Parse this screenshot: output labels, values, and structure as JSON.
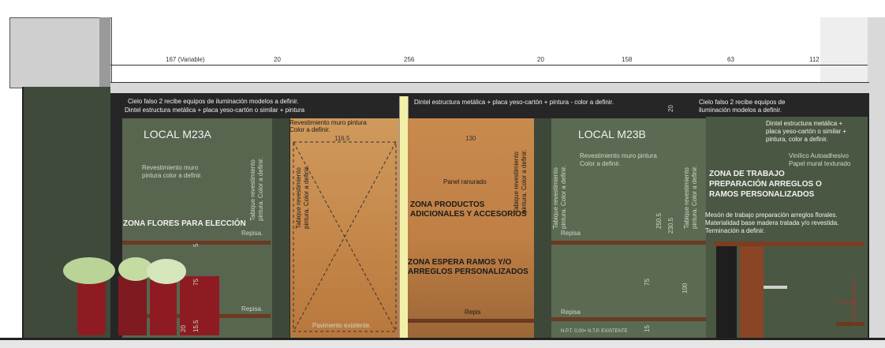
{
  "dimensions_top": [
    "167 (Variable)",
    "20",
    "256",
    "20",
    "158",
    "63",
    "112"
  ],
  "labels": {
    "ceiling_a": "Cielo falso 2 recibe equipos de iluminación modelos a definir.",
    "lintel_a": "Dintel estructura metálica + placa yeso-cartón o similar + pintura",
    "lintel_center": "Dintel estructura metálica + placa yeso-cartón + pintura - color a definir.",
    "ceiling_b_1": "Cielo falso 2 recibe equipos de",
    "ceiling_b_2": "iluminación modelos a definir.",
    "local_a": "LOCAL M23A",
    "local_b": "LOCAL M23B",
    "wall_a_1": "Revestimiento muro",
    "wall_a_2": "pintura color a definir.",
    "wall_b_1": "Revestimiento muro pintura",
    "wall_b_2": "Color a definir.",
    "wall_mid_1": "Revestimiento muro pintura",
    "wall_mid_2": "Color a definir.",
    "partition_1": "Tabique revestimiento",
    "partition_2": "pintura. Color a definir.",
    "panel": "Panel ranurado",
    "zone_flowers": "ZONA FLORES PARA ELECCIÓN",
    "zone_products_1": "ZONA PRODUCTOS",
    "zone_products_2": "ADICIONALES Y ACCESORIOS",
    "zone_wait_1": "ZONA ESPERA RAMOS Y/O",
    "zone_wait_2": "ARREGLOS PERSONALIZADOS",
    "zone_work_1": "ZONA DE TRABAJO",
    "zone_work_2": "PREPARACIÓN ARREGLOS O",
    "zone_work_3": "RAMOS PERSONALIZADOS",
    "lintel_b_1": "Dintel estructura metálica +",
    "lintel_b_2": "placa yeso-cartón o similar +",
    "lintel_b_3": "pintura, color a definir.",
    "vinyl_1": "Vinílico Autoadhesivo",
    "vinyl_2": "Papel mural texturado",
    "desk_1": "Mesón de trabajo preparación arreglos florales.",
    "desk_2": "Materialidad base madera tratada y/o revestida.",
    "desk_3": "Terminación a definir.",
    "shelf": "Repisa.",
    "shelf_b": "Repisa",
    "shelves_center": "Repis",
    "floor": "Pavimento existente.",
    "npt": "N.P.T. 0,00= N.T.P. EXISTENTE"
  },
  "dims_inner": {
    "d116": "116.5",
    "d130": "130",
    "d20a": "20",
    "d250": "250.5",
    "d230": "230.5",
    "d75a": "75",
    "d100": "100",
    "d15": "15",
    "d5": "5",
    "d75b": "75",
    "d20b": "20",
    "d155": "15.5"
  },
  "colors": {
    "wall_green": "#58654f",
    "dark": "#232323",
    "wood": "#c88a4f",
    "pot_red": "#8e1b22",
    "dim_line": "#cc2222"
  }
}
